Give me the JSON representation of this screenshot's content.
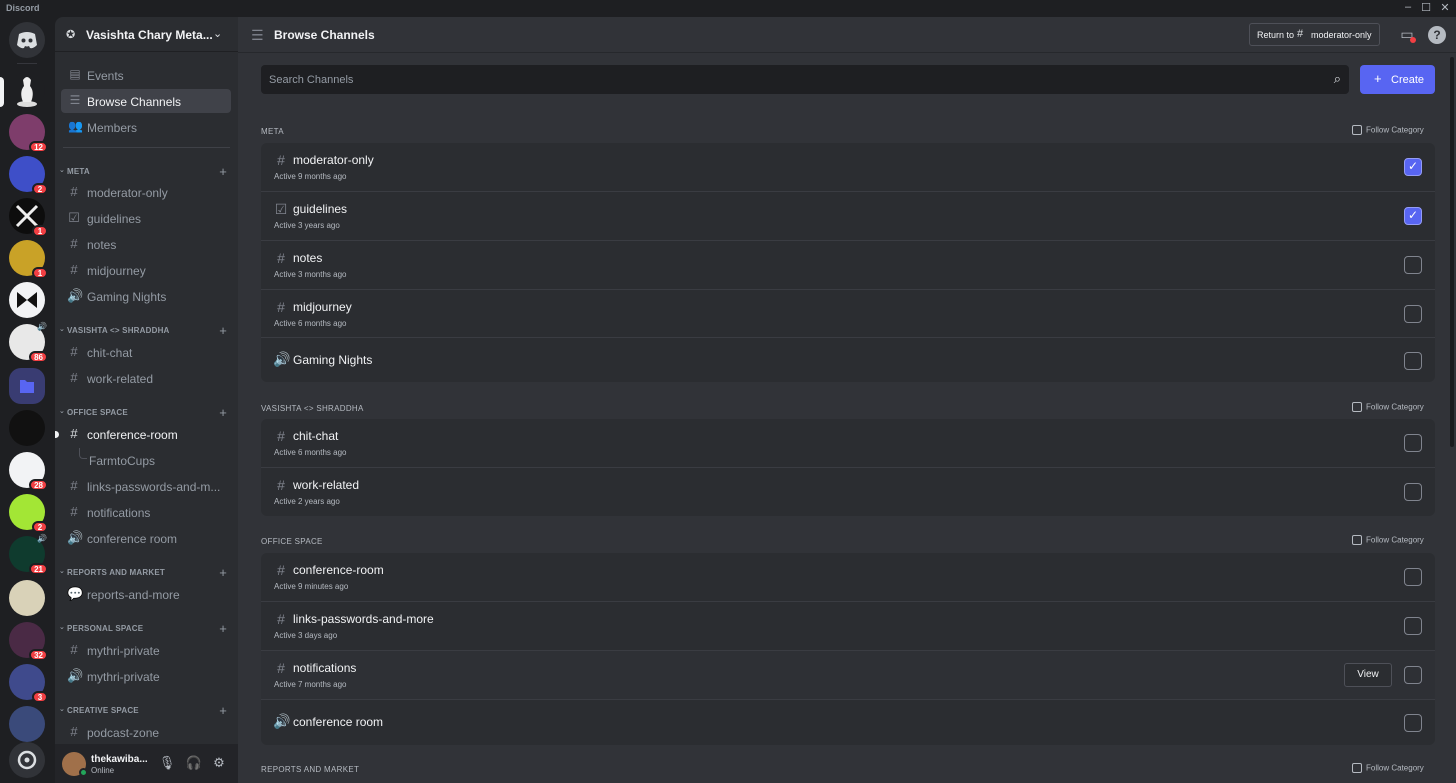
{
  "window": {
    "title": "Discord",
    "controls": [
      "–",
      "☐",
      "✕"
    ]
  },
  "servers": [
    {
      "name": "direct-messages",
      "badge": ""
    },
    {
      "name": "server-1",
      "badge": "",
      "active": true
    },
    {
      "name": "server-2",
      "badge": "12"
    },
    {
      "name": "server-3",
      "badge": "2"
    },
    {
      "name": "server-4",
      "badge": "1"
    },
    {
      "name": "server-5",
      "badge": "1"
    },
    {
      "name": "server-6",
      "badge": ""
    },
    {
      "name": "server-7",
      "badge": "86"
    },
    {
      "name": "folder",
      "badge": ""
    },
    {
      "name": "server-8",
      "badge": ""
    },
    {
      "name": "server-9",
      "badge": "28"
    },
    {
      "name": "server-10",
      "badge": "2"
    },
    {
      "name": "server-11",
      "badge": "21"
    },
    {
      "name": "server-12",
      "badge": ""
    },
    {
      "name": "server-13",
      "badge": "32"
    },
    {
      "name": "server-14",
      "badge": "3"
    },
    {
      "name": "server-15",
      "badge": ""
    },
    {
      "name": "discover",
      "badge": ""
    }
  ],
  "guild": {
    "name": "Vasishta Chary Meta..."
  },
  "nav": {
    "events": "Events",
    "browse": "Browse Channels",
    "members": "Members"
  },
  "sidebar_categories": {
    "meta": "META",
    "vs": "VASISHTA <> SHRADDHA",
    "office": "OFFICE SPACE",
    "reports": "REPORTS AND MARKET",
    "personal": "PERSONAL SPACE",
    "creative": "CREATIVE SPACE"
  },
  "sidebar_channels": {
    "moderator_only": "moderator-only",
    "guidelines": "guidelines",
    "notes": "notes",
    "midjourney": "midjourney",
    "gaming_nights": "Gaming Nights",
    "chit_chat": "chit-chat",
    "work_related": "work-related",
    "conference_room": "conference-room",
    "farmtocups": "FarmtoCups",
    "links": "links-passwords-and-m...",
    "notifications": "notifications",
    "conference_room_voice": "conference room",
    "reports_and_more": "reports-and-more",
    "mythri_private": "mythri-private",
    "mythri_private_voice": "mythri-private",
    "podcast_zone": "podcast-zone"
  },
  "user": {
    "name": "thekawiba...",
    "status": "Online"
  },
  "topbar": {
    "title": "Browse Channels",
    "return_prefix": "Return to",
    "return_channel": "moderator-only"
  },
  "search": {
    "placeholder": "Search Channels"
  },
  "create_label": "Create",
  "follow_label": "Follow Category",
  "view_label": "View",
  "sections": {
    "meta": {
      "title": "META",
      "rows": [
        {
          "name": "moderator-only",
          "active": "Active 9 months ago",
          "checked": true
        },
        {
          "name": "guidelines",
          "active": "Active 3 years ago",
          "checked": true
        },
        {
          "name": "notes",
          "active": "Active 3 months ago",
          "checked": false
        },
        {
          "name": "midjourney",
          "active": "Active 6 months ago",
          "checked": false
        },
        {
          "name": "Gaming Nights",
          "active": "",
          "checked": false
        }
      ]
    },
    "vs": {
      "title": "VASISHTA <> SHRADDHA",
      "rows": [
        {
          "name": "chit-chat",
          "active": "Active 6 months ago",
          "checked": false
        },
        {
          "name": "work-related",
          "active": "Active 2 years ago",
          "checked": false
        }
      ]
    },
    "office": {
      "title": "OFFICE SPACE",
      "rows": [
        {
          "name": "conference-room",
          "active": "Active 9 minutes ago",
          "checked": false
        },
        {
          "name": "links-passwords-and-more",
          "active": "Active 3 days ago",
          "checked": false
        },
        {
          "name": "notifications",
          "active": "Active 7 months ago",
          "checked": false
        },
        {
          "name": "conference room",
          "active": "",
          "checked": false
        }
      ]
    },
    "reports": {
      "title": "REPORTS AND MARKET"
    }
  },
  "colors": {
    "accent": "#5865f2",
    "badge": "#f23f43",
    "online": "#23a55a"
  }
}
